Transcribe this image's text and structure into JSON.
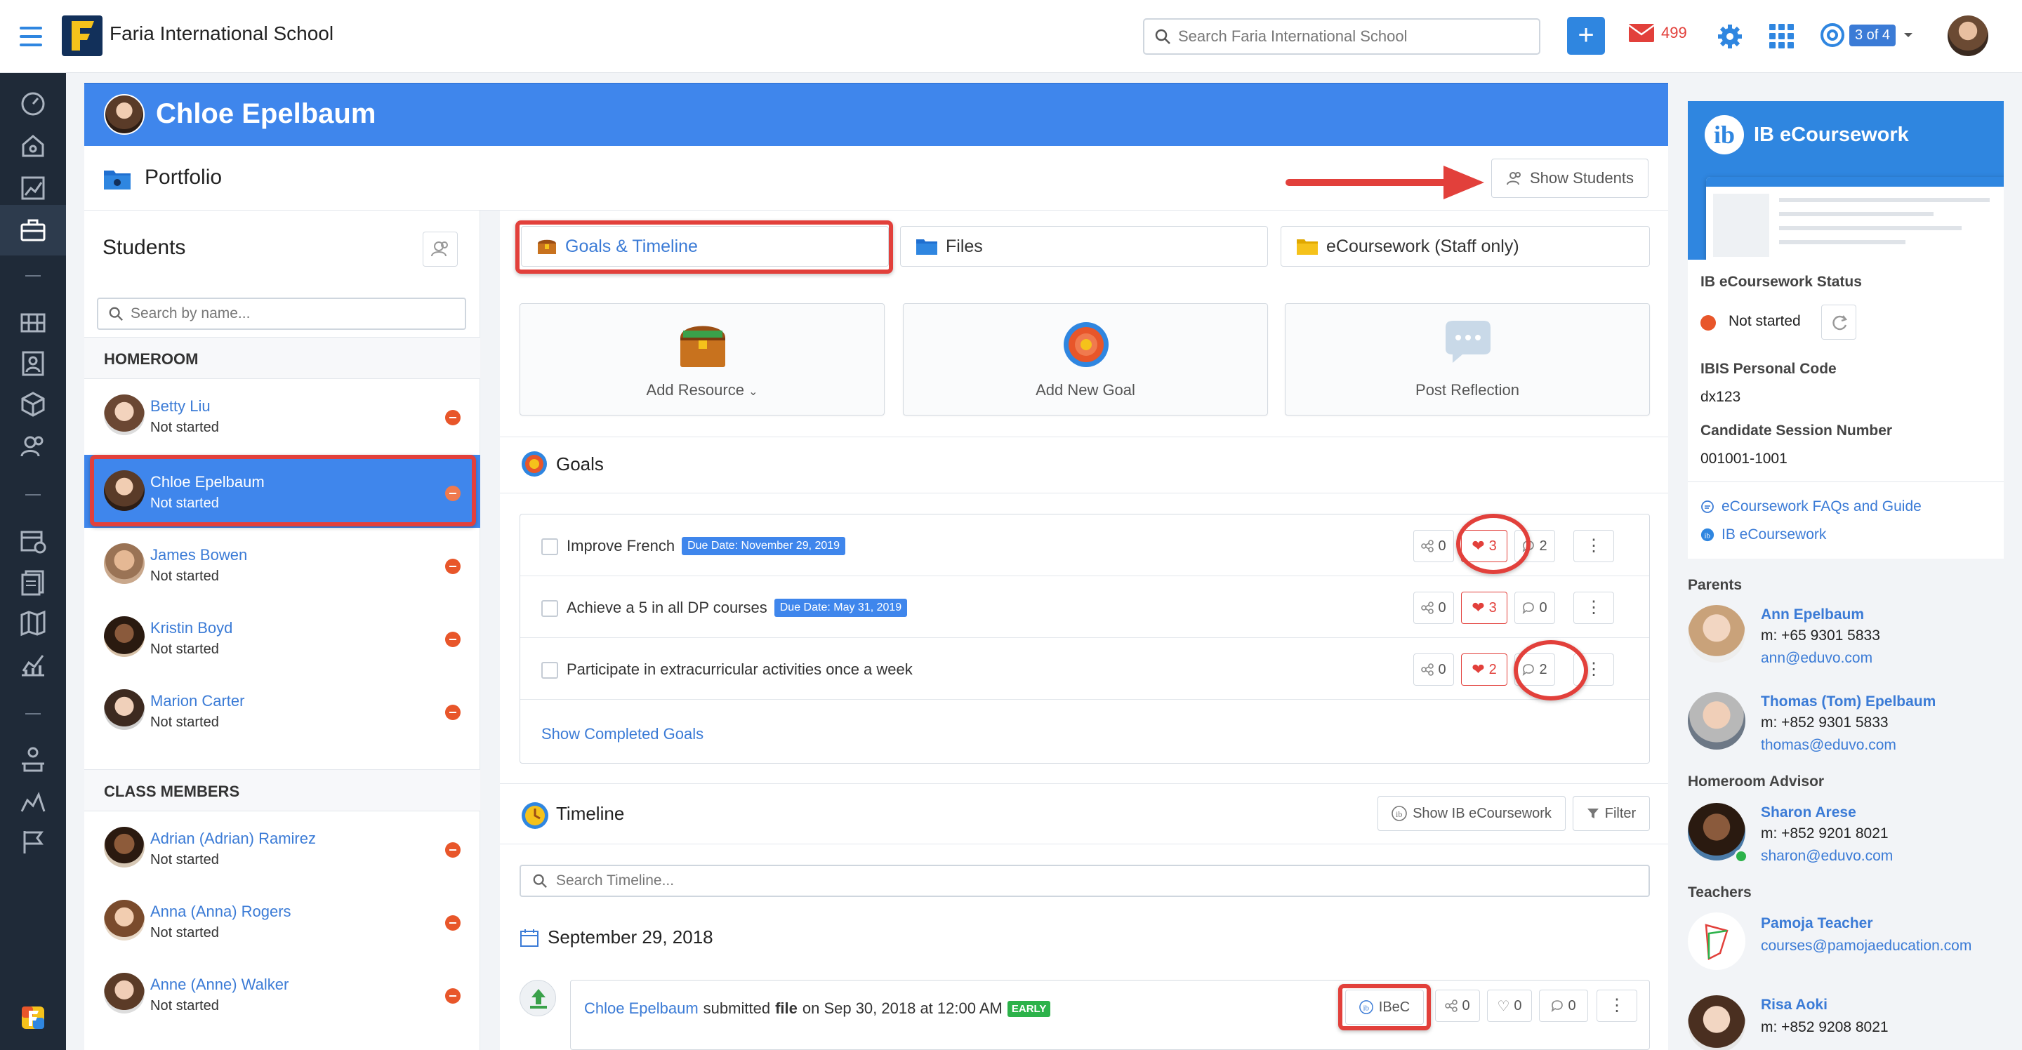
{
  "app": {
    "title": "Faria International School",
    "logo_letter": "F"
  },
  "topbar": {
    "search_placeholder": "Search Faria International School",
    "plus_label": "+",
    "mail_count": "499",
    "profile_badge": "3 of 4"
  },
  "student_header": {
    "name": "Chloe Epelbaum"
  },
  "portfolio": {
    "title": "Portfolio",
    "show_students_label": "Show Students"
  },
  "students": {
    "title": "Students",
    "search_placeholder": "Search by name...",
    "homeroom_label": "HOMEROOM",
    "class_members_label": "CLASS MEMBERS",
    "homeroom": [
      {
        "name": "Betty Liu",
        "status": "Not started"
      },
      {
        "name": "Chloe Epelbaum",
        "status": "Not started"
      },
      {
        "name": "James Bowen",
        "status": "Not started"
      },
      {
        "name": "Kristin Boyd",
        "status": "Not started"
      },
      {
        "name": "Marion Carter",
        "status": "Not started"
      }
    ],
    "class_members": [
      {
        "name": "Adrian (Adrian) Ramirez",
        "status": "Not started"
      },
      {
        "name": "Anna (Anna) Rogers",
        "status": "Not started"
      },
      {
        "name": "Anne (Anne) Walker",
        "status": "Not started"
      }
    ]
  },
  "tabs": [
    {
      "label": "Goals & Timeline"
    },
    {
      "label": "Files"
    },
    {
      "label": "eCoursework (Staff only)"
    }
  ],
  "actions": [
    {
      "label": "Add Resource"
    },
    {
      "label": "Add New Goal"
    },
    {
      "label": "Post Reflection"
    }
  ],
  "goals": {
    "title": "Goals",
    "items": [
      {
        "text": "Improve French",
        "due": "Due Date: November 29, 2019",
        "shares": "0",
        "likes": "3",
        "comments": "2"
      },
      {
        "text": "Achieve a 5 in all DP courses",
        "due": "Due Date: May 31, 2019",
        "shares": "0",
        "likes": "3",
        "comments": "0"
      },
      {
        "text": "Participate in extracurricular activities once a week",
        "due": "",
        "shares": "0",
        "likes": "2",
        "comments": "2"
      }
    ],
    "show_completed": "Show Completed Goals"
  },
  "timeline": {
    "title": "Timeline",
    "show_ibec_label": "Show IB eCoursework",
    "filter_label": "Filter",
    "search_placeholder": "Search Timeline...",
    "date": "September 29, 2018",
    "entry": {
      "author": "Chloe Epelbaum",
      "verb": "submitted",
      "object": "file",
      "when": "on Sep 30, 2018 at 12:00 AM",
      "badge": "EARLY",
      "chip": "IBeC",
      "shares": "0",
      "likes": "0",
      "comments": "0"
    }
  },
  "ib_ecoursework": {
    "title": "IB eCoursework",
    "status_label": "IB eCoursework Status",
    "status_value": "Not started",
    "personal_code_label": "IBIS Personal Code",
    "personal_code_value": "dx123",
    "session_label": "Candidate Session Number",
    "session_value": "001001-1001",
    "faq_link": "eCoursework FAQs and Guide",
    "ib_link": "IB eCoursework"
  },
  "contacts": {
    "parents_label": "Parents",
    "parents": [
      {
        "name": "Ann Epelbaum",
        "phone": "m: +65 9301 5833",
        "email": "ann@eduvo.com"
      },
      {
        "name": "Thomas (Tom) Epelbaum",
        "phone": "m: +852 9301 5833",
        "email": "thomas@eduvo.com"
      }
    ],
    "advisor_label": "Homeroom Advisor",
    "advisor": {
      "name": "Sharon Arese",
      "phone": "m: +852 9201 8021",
      "email": "sharon@eduvo.com"
    },
    "teachers_label": "Teachers",
    "teachers": [
      {
        "name": "Pamoja Teacher",
        "email": "courses@pamojaeducation.com"
      },
      {
        "name": "Risa Aoki",
        "phone": "m: +852 9208 8021"
      }
    ]
  },
  "colors": {
    "brand_blue": "#3f86ec",
    "accent_red": "#e2403b",
    "early_green": "#2cb24a"
  }
}
